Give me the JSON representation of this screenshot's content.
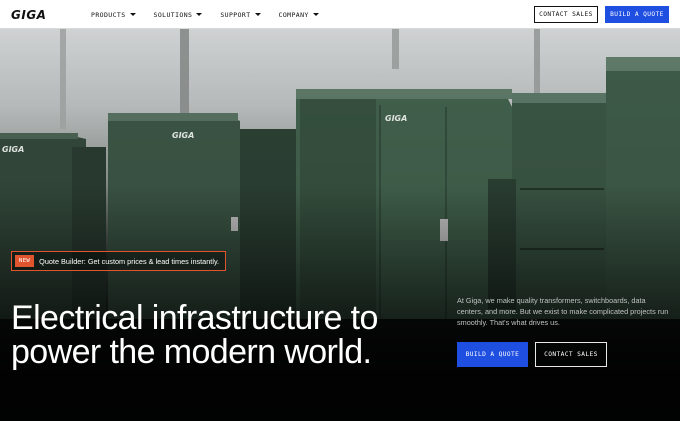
{
  "brand": {
    "logo_text": "GIGA"
  },
  "nav": {
    "menu": [
      {
        "label": "PRODUCTS"
      },
      {
        "label": "SOLUTIONS"
      },
      {
        "label": "SUPPORT"
      },
      {
        "label": "COMPANY"
      }
    ],
    "contact_label": "CONTACT SALES",
    "quote_label": "BUILD A QUOTE"
  },
  "hero": {
    "badge_tag": "NEW",
    "badge_text": "Quote Builder: Get custom prices & lead times instantly.",
    "headline": "Electrical infrastructure to power the modern world.",
    "blurb": "At Giga, we make quality transformers, switchboards, data centers, and more. But we exist to make complicated projects run smoothly. That's what drives us.",
    "cta_quote": "BUILD A QUOTE",
    "cta_contact": "CONTACT SALES",
    "image": {
      "description_icon": "photo-electrical-cabinets",
      "cabinet_logo": "GIGA"
    }
  },
  "colors": {
    "accent_blue": "#1f4fe0",
    "badge_orange": "#e0552e",
    "cabinet_green": "#3f5d48"
  }
}
